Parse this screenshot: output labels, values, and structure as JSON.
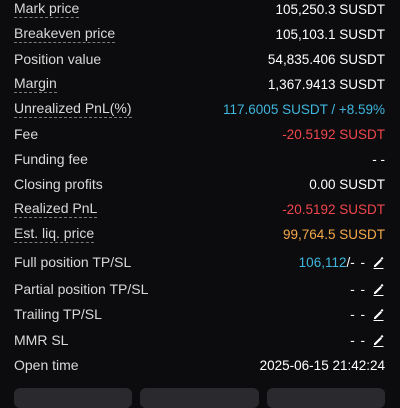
{
  "rows": [
    {
      "label": "Mark price",
      "value": "105,250.3 SUSDT"
    },
    {
      "label": "Breakeven price",
      "value": "105,103.1 SUSDT"
    },
    {
      "label": "Position value",
      "value": "54,835.406 SUSDT"
    },
    {
      "label": "Margin",
      "value": "1,367.9413 SUSDT"
    },
    {
      "label": "Unrealized PnL(%)",
      "value": "117.6005 SUSDT / +8.59%"
    },
    {
      "label": "Fee",
      "value": "-20.5192 SUSDT"
    },
    {
      "label": "Funding fee",
      "value": "- -"
    },
    {
      "label": "Closing profits",
      "value": "0.00 SUSDT"
    },
    {
      "label": "Realized PnL",
      "value": "-20.5192 SUSDT"
    },
    {
      "label": "Est. liq. price",
      "value": "99,764.5 SUSDT"
    },
    {
      "label": "Full position TP/SL",
      "tp": "106,112",
      "sep": "/",
      "sl": "- -"
    },
    {
      "label": "Partial position TP/SL",
      "value": "- -"
    },
    {
      "label": "Trailing TP/SL",
      "value": "- -"
    },
    {
      "label": "MMR SL",
      "value": "- -"
    },
    {
      "label": "Open time",
      "value": "2025-06-15 21:42:24"
    }
  ],
  "colors": {
    "background": "#0c0c0e",
    "text": "#ffffff",
    "positive": "#3fb6dd",
    "negative": "#f0464c",
    "warning": "#f5a94a"
  },
  "icons": {
    "edit": "pencil-edit-icon"
  }
}
